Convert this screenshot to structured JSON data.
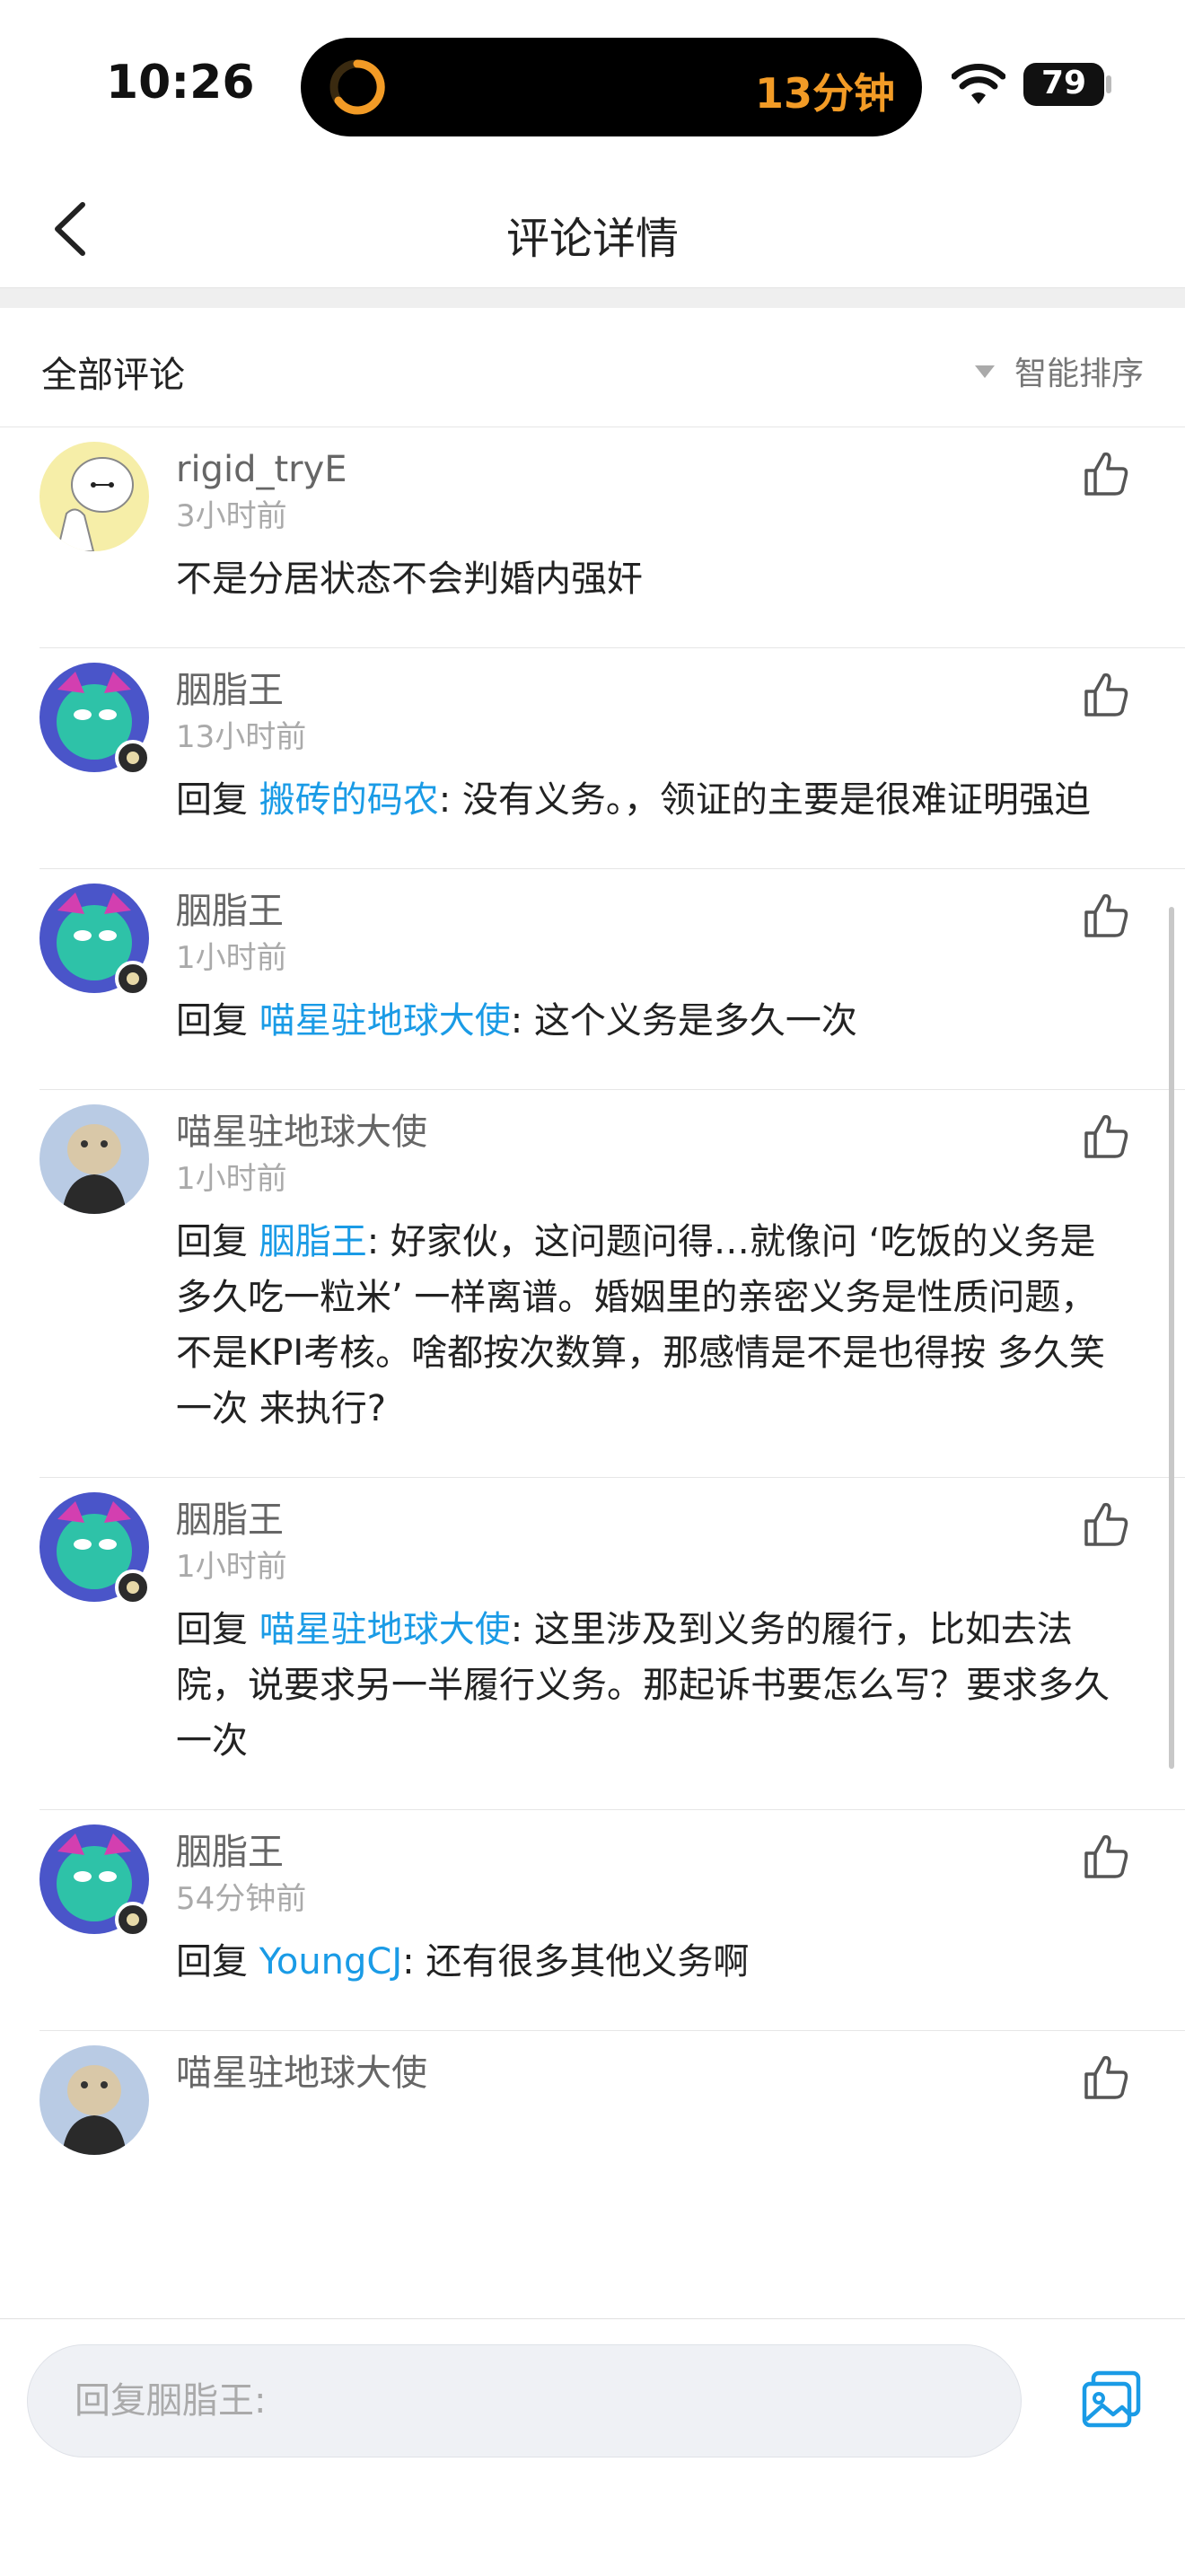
{
  "status_bar": {
    "time": "10:26",
    "timer_text": "13分钟",
    "battery": "79"
  },
  "nav": {
    "title": "评论详情"
  },
  "section": {
    "title": "全部评论",
    "sort_label": "智能排序"
  },
  "comments": [
    {
      "user": "rigid_tryE",
      "time": "3小时前",
      "reply_prefix": "",
      "reply_to": "",
      "text": "不是分居状态不会判婚内强奸"
    },
    {
      "user": "胭脂王",
      "time": "13小时前",
      "reply_prefix": "回复 ",
      "reply_to": "搬砖的码农",
      "text": ": 没有义务。，领证的主要是很难证明强迫"
    },
    {
      "user": "胭脂王",
      "time": "1小时前",
      "reply_prefix": "回复 ",
      "reply_to": "喵星驻地球大使",
      "text": ": 这个义务是多久一次"
    },
    {
      "user": "喵星驻地球大使",
      "time": "1小时前",
      "reply_prefix": "回复 ",
      "reply_to": "胭脂王",
      "text": ": 好家伙，这问题问得…就像问 ‘吃饭的义务是多久吃一粒米’ 一样离谱。婚姻里的亲密义务是性质问题，不是KPI考核。啥都按次数算，那感情是不是也得按 多久笑一次 来执行?"
    },
    {
      "user": "胭脂王",
      "time": "1小时前",
      "reply_prefix": "回复 ",
      "reply_to": "喵星驻地球大使",
      "text": ": 这里涉及到义务的履行，比如去法院，说要求另一半履行义务。那起诉书要怎么写？要求多久一次"
    },
    {
      "user": "胭脂王",
      "time": "54分钟前",
      "reply_prefix": "回复 ",
      "reply_to": "YoungCJ",
      "text": ": 还有很多其他义务啊"
    },
    {
      "user": "喵星驻地球大使",
      "time": "",
      "reply_prefix": "",
      "reply_to": "",
      "text": ""
    }
  ],
  "input": {
    "placeholder": "回复胭脂王:"
  },
  "colors": {
    "link": "#1a9be6",
    "timer": "#f29b26"
  }
}
